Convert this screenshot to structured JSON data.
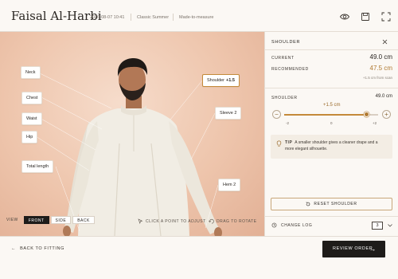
{
  "header": {
    "customer_name": "Faisal Al-Harbi",
    "date": "2026-08-07 10:41",
    "collection": "Classic Summer",
    "service": "Made-to-measure"
  },
  "viewport": {
    "labels": {
      "neck": "Neck",
      "chest": "Chest",
      "waist": "Waist",
      "hip": "Hip",
      "total_length": "Total length",
      "shoulder": "Shoulder",
      "shoulder_delta": "+1.5",
      "sleeve": "Sleeve",
      "sleeve_count": "2",
      "hem": "Hem",
      "hem_count": "2"
    },
    "view": {
      "label": "VIEW",
      "options": [
        "FRONT",
        "SIDE",
        "BACK"
      ],
      "selected": "FRONT"
    },
    "hints": {
      "click": "CLICK A POINT TO ADJUST",
      "drag": "DRAG TO ROTATE"
    }
  },
  "panel": {
    "title": "SHOULDER",
    "current_label": "CURRENT",
    "current_value": "49.0 cm",
    "recommended_label": "RECOMMENDED",
    "recommended_value": "47.5 cm",
    "from_scan": "+1.5 cm from scan",
    "slider": {
      "label": "SHOULDER",
      "value_text": "49.0 cm",
      "delta_text": "+1.5 cm",
      "min": -2,
      "max": 2,
      "value": 1.5,
      "ticks": [
        "-2",
        "0",
        "+2"
      ]
    },
    "tip": {
      "label": "TIP",
      "text": "A smaller shoulder gives a cleaner drape and a more elegant silhouette."
    },
    "reset_label": "RESET SHOULDER",
    "change_log_label": "CHANGE LOG",
    "change_log_count": "3"
  },
  "footer": {
    "back_label": "BACK TO FITTING",
    "review_label": "REVIEW ORDER"
  },
  "colors": {
    "accent": "#b07a32",
    "dark": "#1e1c1a",
    "background": "#fbf8f4",
    "viewport": "#eec5ac"
  }
}
